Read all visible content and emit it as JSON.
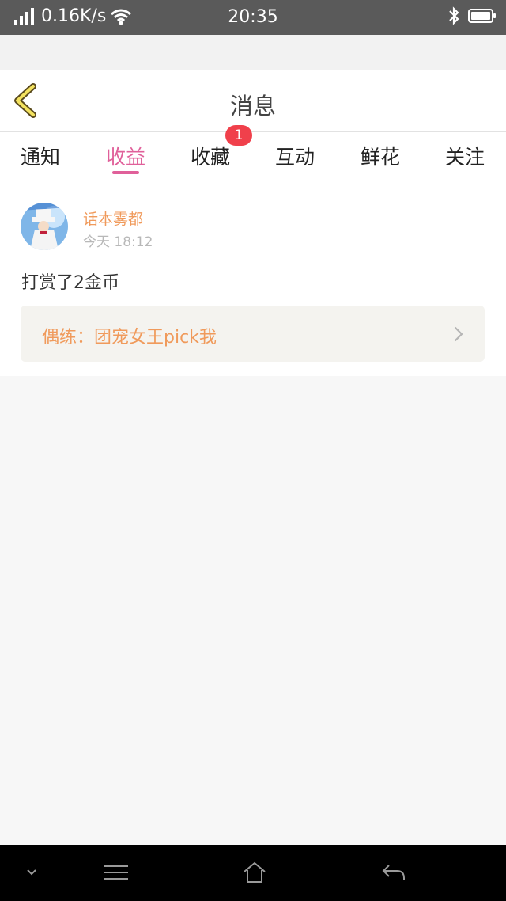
{
  "status_bar": {
    "network_speed": "0.16K/s",
    "time": "20:35",
    "icons": [
      "signal-icon",
      "wifi-icon",
      "bluetooth-icon",
      "battery-icon"
    ]
  },
  "header": {
    "title": "消息",
    "back_icon": "chevron-left-icon"
  },
  "tabs": [
    {
      "label": "通知",
      "active": false
    },
    {
      "label": "收益",
      "active": true
    },
    {
      "label": "收藏",
      "active": false,
      "badge": "1"
    },
    {
      "label": "互动",
      "active": false
    },
    {
      "label": "鲜花",
      "active": false
    },
    {
      "label": "关注",
      "active": false
    }
  ],
  "message": {
    "user_name": "话本雾都",
    "time": "今天 18:12",
    "text": "打赏了2金币",
    "link_text": "偶练：团宠女王pick我"
  },
  "colors": {
    "accent": "#e0609a",
    "badge": "#f0404b",
    "username": "#f09a5b",
    "status_bar": "#5a5a5a"
  },
  "nav_bar": {
    "icons": [
      "chevron-down-icon",
      "menu-icon",
      "home-icon",
      "back-icon"
    ]
  }
}
